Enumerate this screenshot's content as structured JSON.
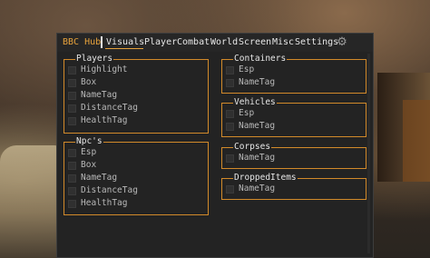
{
  "window": {
    "brand": "BBC Hub",
    "tabs": [
      "Visuals",
      "Player",
      "Combat",
      "World",
      "Screen",
      "Misc",
      "Settings"
    ],
    "active_tab": "Visuals",
    "settings_icon": "gear-icon",
    "accent_color": "#e6a23c",
    "border_color": "#d28a2a"
  },
  "groups": {
    "players": {
      "title": "Players",
      "items": [
        "Highlight",
        "Box",
        "NameTag",
        "DistanceTag",
        "HealthTag"
      ]
    },
    "npcs": {
      "title": "Npc's",
      "items": [
        "Esp",
        "Box",
        "NameTag",
        "DistanceTag",
        "HealthTag"
      ]
    },
    "containers": {
      "title": "Containers",
      "items": [
        "Esp",
        "NameTag"
      ]
    },
    "vehicles": {
      "title": "Vehicles",
      "items": [
        "Esp",
        "NameTag"
      ]
    },
    "corpses": {
      "title": "Corpses",
      "items": [
        "NameTag"
      ]
    },
    "dropped": {
      "title": "DroppedItems",
      "items": [
        "NameTag"
      ]
    }
  }
}
